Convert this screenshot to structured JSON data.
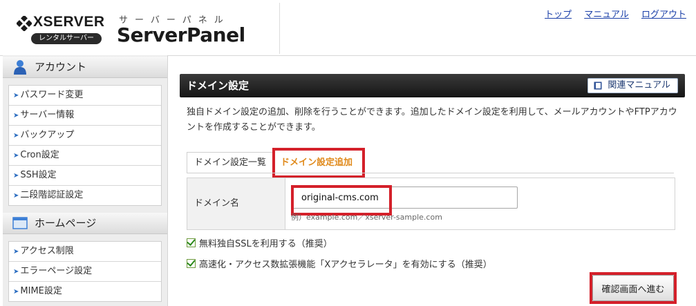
{
  "header": {
    "brand_name": "XSERVER",
    "brand_badge": "レンタルサーバー",
    "panel_subtitle": "サーバーパネル",
    "panel_title": "ServerPanel",
    "nav": {
      "top": "トップ",
      "manual": "マニュアル",
      "logout": "ログアウト"
    }
  },
  "sidebar": {
    "account": {
      "title": "アカウント",
      "items": [
        "パスワード変更",
        "サーバー情報",
        "バックアップ",
        "Cron設定",
        "SSH設定",
        "二段階認証設定"
      ]
    },
    "homepage": {
      "title": "ホームページ",
      "items": [
        "アクセス制限",
        "エラーページ設定",
        "MIME設定"
      ]
    }
  },
  "main": {
    "section_title": "ドメイン設定",
    "manual_button": "関連マニュアル",
    "description": "独自ドメイン設定の追加、削除を行うことができます。追加したドメイン設定を利用して、メールアカウントやFTPアカウントを作成することができます。",
    "tabs": [
      "ドメイン設定一覧",
      "ドメイン設定追加"
    ],
    "form": {
      "domain_label": "ドメイン名",
      "domain_value": "original-cms.com",
      "domain_hint": "例）example.com／xserver-sample.com"
    },
    "checks": {
      "ssl": "無料独自SSLを利用する（推奨）",
      "accelerator": "高速化・アクセス数拡張機能「Xアクセラレータ」を有効にする（推奨）"
    },
    "confirm_button": "確認画面へ進む"
  },
  "colors": {
    "highlight": "#d4202a",
    "active_tab_text": "#e08a1c",
    "link": "#1a3fa8"
  }
}
